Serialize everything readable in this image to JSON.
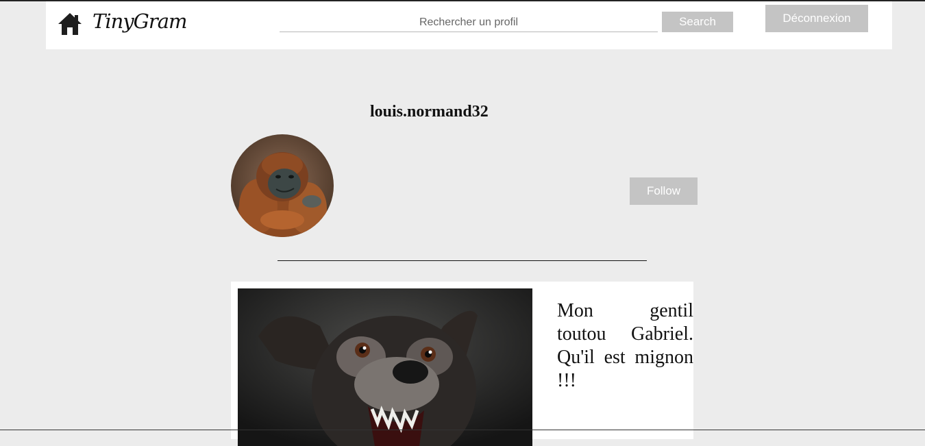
{
  "header": {
    "brand": "TinyGram",
    "search_placeholder": "Rechercher un profil",
    "search_value": "",
    "search_button": "Search",
    "logout_button": "Déconnexion"
  },
  "profile": {
    "username": "louis.normand32",
    "follow_button": "Follow"
  },
  "posts": [
    {
      "caption": "Mon gentil toutou Gabriel. Qu'il est mignon !!!"
    }
  ],
  "icons": {
    "home": "home-icon"
  },
  "colors": {
    "page_background": "#ececec",
    "navbar_background": "#ffffff",
    "button_background": "#c4c4c4",
    "button_text": "#ffffff"
  }
}
